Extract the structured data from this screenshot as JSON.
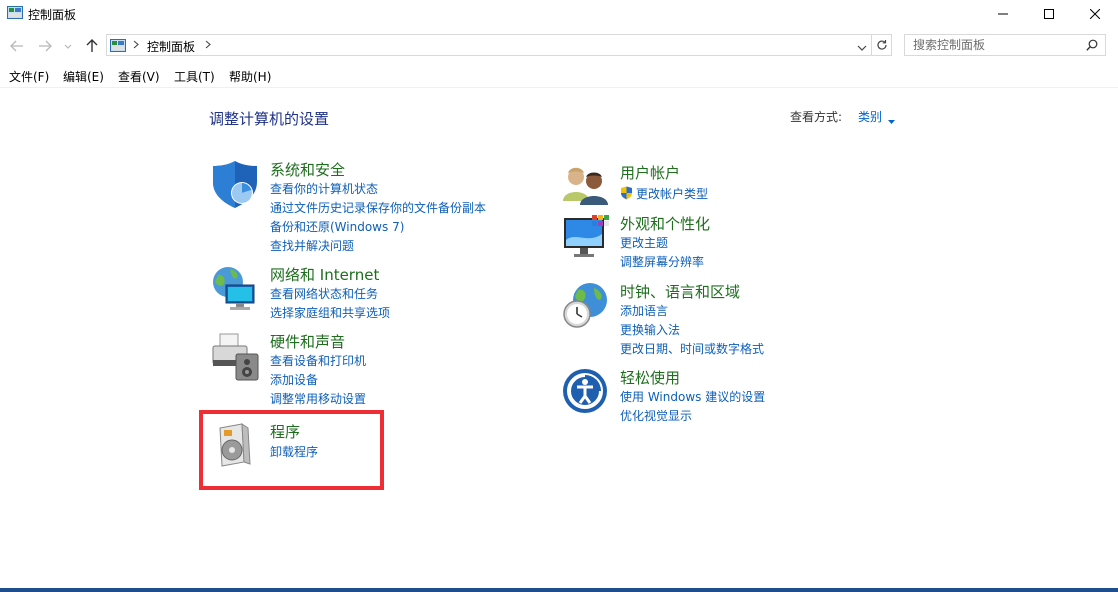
{
  "window": {
    "title": "控制面板",
    "minimize_icon": "minimize-icon",
    "maximize_icon": "maximize-icon",
    "close_icon": "close-icon"
  },
  "address": {
    "crumb": "控制面板",
    "search_placeholder": "搜索控制面板"
  },
  "menu": [
    "文件(F)",
    "编辑(E)",
    "查看(V)",
    "工具(T)",
    "帮助(H)"
  ],
  "main": {
    "heading": "调整计算机的设置",
    "view_by_label": "查看方式:",
    "view_by_value": "类别"
  },
  "categories_left": [
    {
      "title": "系统和安全",
      "icon": "shield-icon",
      "links": [
        "查看你的计算机状态",
        "通过文件历史记录保存你的文件备份副本",
        "备份和还原(Windows 7)",
        "查找并解决问题"
      ]
    },
    {
      "title": "网络和 Internet",
      "icon": "network-icon",
      "links": [
        "查看网络状态和任务",
        "选择家庭组和共享选项"
      ]
    },
    {
      "title": "硬件和声音",
      "icon": "printer-icon",
      "links": [
        "查看设备和打印机",
        "添加设备",
        "调整常用移动设置"
      ]
    },
    {
      "title": "程序",
      "icon": "programs-icon",
      "links": [
        "卸载程序"
      ]
    }
  ],
  "categories_right": [
    {
      "title": "用户帐户",
      "icon": "users-icon",
      "links": [
        "更改帐户类型"
      ]
    },
    {
      "title": "外观和个性化",
      "icon": "monitor-icon",
      "links": [
        "更改主题",
        "调整屏幕分辨率"
      ]
    },
    {
      "title": "时钟、语言和区域",
      "icon": "clock-globe-icon",
      "links": [
        "添加语言",
        "更换输入法",
        "更改日期、时间或数字格式"
      ]
    },
    {
      "title": "轻松使用",
      "icon": "ease-of-access-icon",
      "links": [
        "使用 Windows 建议的设置",
        "优化视觉显示"
      ]
    }
  ],
  "colors": {
    "heading": "#1e3287",
    "category_title": "#1e6e1e",
    "link": "#0e5fb9",
    "highlight": "#ee2d34"
  }
}
